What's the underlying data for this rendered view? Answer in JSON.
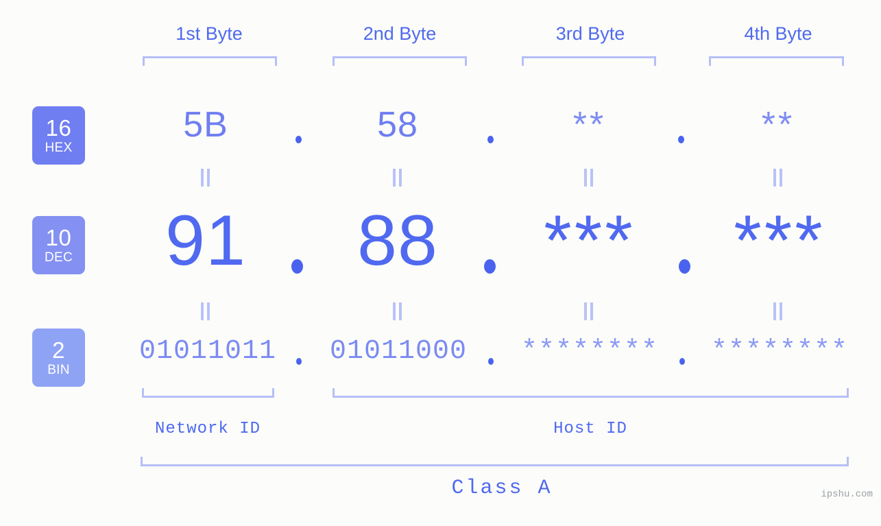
{
  "meta": {
    "background": "#fcfdfa",
    "accent": "#5069f0",
    "accent_light": "#b6bff7",
    "badge_colors": [
      "#6f7ef0",
      "#8491f2",
      "#8fa3f5"
    ]
  },
  "byte_headers": [
    {
      "label": "1st Byte"
    },
    {
      "label": "2nd Byte"
    },
    {
      "label": "3rd Byte"
    },
    {
      "label": "4th Byte"
    }
  ],
  "bases": [
    {
      "num": "16",
      "name": "HEX"
    },
    {
      "num": "10",
      "name": "DEC"
    },
    {
      "num": "2",
      "name": "BIN"
    }
  ],
  "rows": {
    "hex": {
      "values": [
        "5B",
        "58",
        "**",
        "**"
      ]
    },
    "dec": {
      "values": [
        "91",
        "88",
        "***",
        "***"
      ]
    },
    "bin": {
      "values": [
        "01011011",
        "01011000",
        "********",
        "********"
      ]
    }
  },
  "separator": ".",
  "equals_glyph": "=",
  "id_sections": [
    {
      "label": "Network ID"
    },
    {
      "label": "Host ID"
    }
  ],
  "class_label": "Class A",
  "watermark": "ipshu.com"
}
